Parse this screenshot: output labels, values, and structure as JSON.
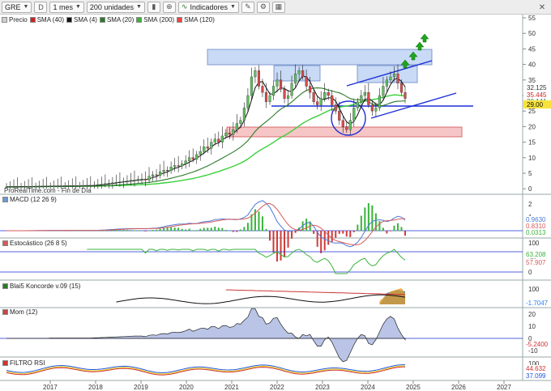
{
  "toolbar": {
    "symbol": "GRE",
    "mode_label": "D",
    "timeframe": "1 mes",
    "units": "200 unidades",
    "indicators_label": "Indicadores"
  },
  "legend": [
    {
      "label": "Precio",
      "color": "#c8c8c8"
    },
    {
      "label": "SMA (40)",
      "color": "#cc2222"
    },
    {
      "label": "SMA (4)",
      "color": "#111111"
    },
    {
      "label": "SMA (20)",
      "color": "#2a7a2a"
    },
    {
      "label": "SMA (200)",
      "color": "#3bb33b"
    },
    {
      "label": "SMA (120)",
      "color": "#ee4444"
    }
  ],
  "source_label": "ProRealTime.com - Fin de Día",
  "price_axis": {
    "ticks": [
      "55",
      "50",
      "45",
      "40",
      "35",
      "30",
      "25",
      "20",
      "15",
      "10",
      "5",
      "0"
    ],
    "tag_sma40": "35.445",
    "tag_close": "32.125",
    "tag_sma20": "30.141",
    "tag_last": "29.00"
  },
  "panels": {
    "macd": {
      "label": "MACD (12 26 9)",
      "ticks": [
        "2",
        "1",
        "0"
      ],
      "tag1": "0.9630",
      "tag2": "0.8310",
      "tag3": "0.0313"
    },
    "stoch": {
      "label": "Estocástico (26 8 5)",
      "ticks": [
        "100",
        "50",
        "0"
      ],
      "tag1": "63.208",
      "tag2": "57.907"
    },
    "blai5": {
      "label": "Blai5 Koncorde v.09 (15)",
      "ticks": [
        "100",
        "0"
      ],
      "tag1": "-1.7047"
    },
    "mom": {
      "label": "Mom (12)",
      "ticks": [
        "20",
        "10",
        "0",
        "-10"
      ],
      "tag1": "-5.2400"
    },
    "rsi": {
      "label": "FILTRO RSI",
      "ticks": [
        "100",
        "0"
      ],
      "tag1": "44.632",
      "tag2": "37.099"
    }
  },
  "x_axis": {
    "years": [
      "2017",
      "2018",
      "2019",
      "2020",
      "2021",
      "2022",
      "2023",
      "2024",
      "2025",
      "2026",
      "2027"
    ]
  },
  "colors": {
    "accent_blue": "#1a2fd6",
    "zone_blue": "#c8daf5",
    "zone_red": "#f6c6c6"
  }
}
